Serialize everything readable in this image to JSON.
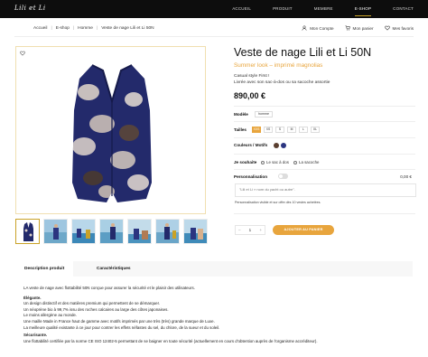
{
  "header": {
    "logo": "Lili et Li",
    "nav": [
      "ACCUEIL",
      "PRODUIT",
      "MEMBRE",
      "E-SHOP",
      "CONTACT"
    ],
    "active_nav": "E-SHOP"
  },
  "breadcrumb": [
    "Accueil",
    "E-shop",
    "Homme",
    "Veste de nage Lili et Li 50N"
  ],
  "account": {
    "my_account": "Mon Compte",
    "my_cart": "Mon panier",
    "my_favorites": "Mes favoris"
  },
  "product": {
    "title": "Veste de nage Lili et Li 50N",
    "subtitle": "Summer look – imprimé magnolias",
    "desc_line1": "Casual style First !",
    "desc_line2": "Livrée avec son sac-à-dos ou sa sacoche assortie",
    "price": "890,00 €"
  },
  "options": {
    "model_label": "Modèle",
    "model_value": "homme",
    "sizes_label": "Tailles",
    "sizes": [
      "XXS",
      "XS",
      "S",
      "M",
      "L",
      "XL"
    ],
    "selected_size": "XXS",
    "colors_label": "Couleurs / Motifs",
    "colors": [
      "#5a3f2f",
      "#2b3580"
    ],
    "wish_label": "Je souhaite",
    "wish_options": [
      "Le sac à dos",
      "La sacoche"
    ],
    "perso_label": "Personnalisation",
    "perso_price": "0,00 €",
    "perso_placeholder": "\"Lili et Li » nom du yacht ou autre\".",
    "perso_note": "Personnalisation visible et sur offre dès 10 vestes achetées."
  },
  "cart": {
    "qty_minus": "–",
    "qty_value": "1",
    "qty_plus": "+",
    "add_label": "AJOUTER AU PANIER"
  },
  "tabs": [
    "Description produit",
    "Caractéristiques"
  ],
  "description": {
    "intro": "LA veste de nage avec flottabilité 50N conçue pour assurer la sécurité et le plaisir des utilisateurs.",
    "elegance_title": "Élégante.",
    "elegance_lines": [
      "Un design distinctif et des matières premium qui permettent de se démarquer.",
      "Un néoprène bio à 99,7% issu des roches calcaires au large des côtes japonaises.",
      "Le moins allergène au monde.",
      "Une maille Made in France haut de gamme avec motifs imprimés par une très (très) grande marque de Luxe.",
      "La meilleure qualité existante à ce jour pour contrer les effets néfastes du sel, du chlore, de la sueur et du soleil."
    ],
    "security_title": "Sécurisante.",
    "security_lines": [
      "Une flottabilité certifiée par la norme CE ISO 12402-5 permettant de se baigner en toute sécurité (actuellement en cours d'obtention auprès de l'organisme accréditeur)."
    ]
  }
}
